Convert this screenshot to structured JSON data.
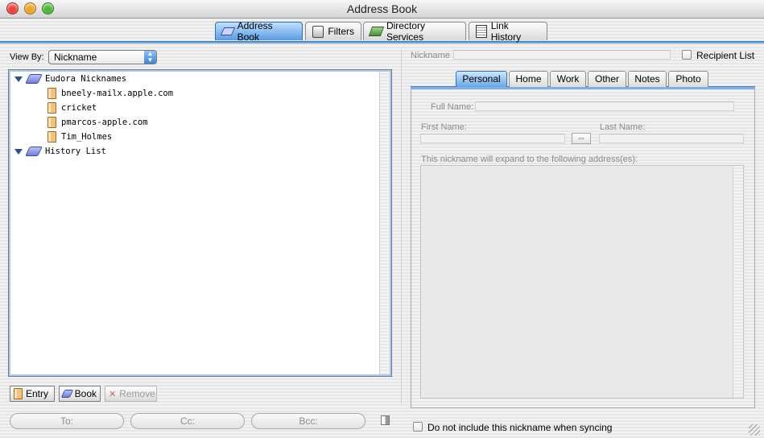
{
  "window": {
    "title": "Address Book"
  },
  "toolbar_tabs": [
    {
      "label": "Address Book",
      "icon": "book-icon",
      "active": true
    },
    {
      "label": "Filters",
      "icon": "filters-icon",
      "active": false
    },
    {
      "label": "Directory Services",
      "icon": "directory-services-icon",
      "active": false
    },
    {
      "label": "Link History",
      "icon": "link-history-icon",
      "active": false
    }
  ],
  "view_by": {
    "label": "View By:",
    "value": "Nickname"
  },
  "tree": {
    "groups": [
      {
        "label": "Eudora Nicknames",
        "items": [
          "bneely-mailx.apple.com",
          "cricket",
          "pmarcos-apple.com",
          "Tim_Holmes"
        ]
      },
      {
        "label": "History List",
        "items": []
      }
    ]
  },
  "buttons": {
    "entry": "Entry",
    "book": "Book",
    "remove": "Remove"
  },
  "recipients": {
    "to": "To:",
    "cc": "Cc:",
    "bcc": "Bcc:"
  },
  "detail": {
    "nickname_label": "Nickname",
    "recipient_list_label": "Recipient List",
    "tabs": [
      "Personal",
      "Home",
      "Work",
      "Other",
      "Notes",
      "Photo"
    ],
    "active_tab": "Personal",
    "full_name_label": "Full Name:",
    "first_name_label": "First Name:",
    "last_name_label": "Last Name:",
    "swap_symbol": "⇔",
    "address_caption": "This nickname will expand to the following address(es):",
    "sync_label": "Do not include this nickname when syncing"
  },
  "colors": {
    "accent": "#5b9be0",
    "tab_active_top": "#bfe0ff",
    "disclosure": "#2d4f8a"
  }
}
